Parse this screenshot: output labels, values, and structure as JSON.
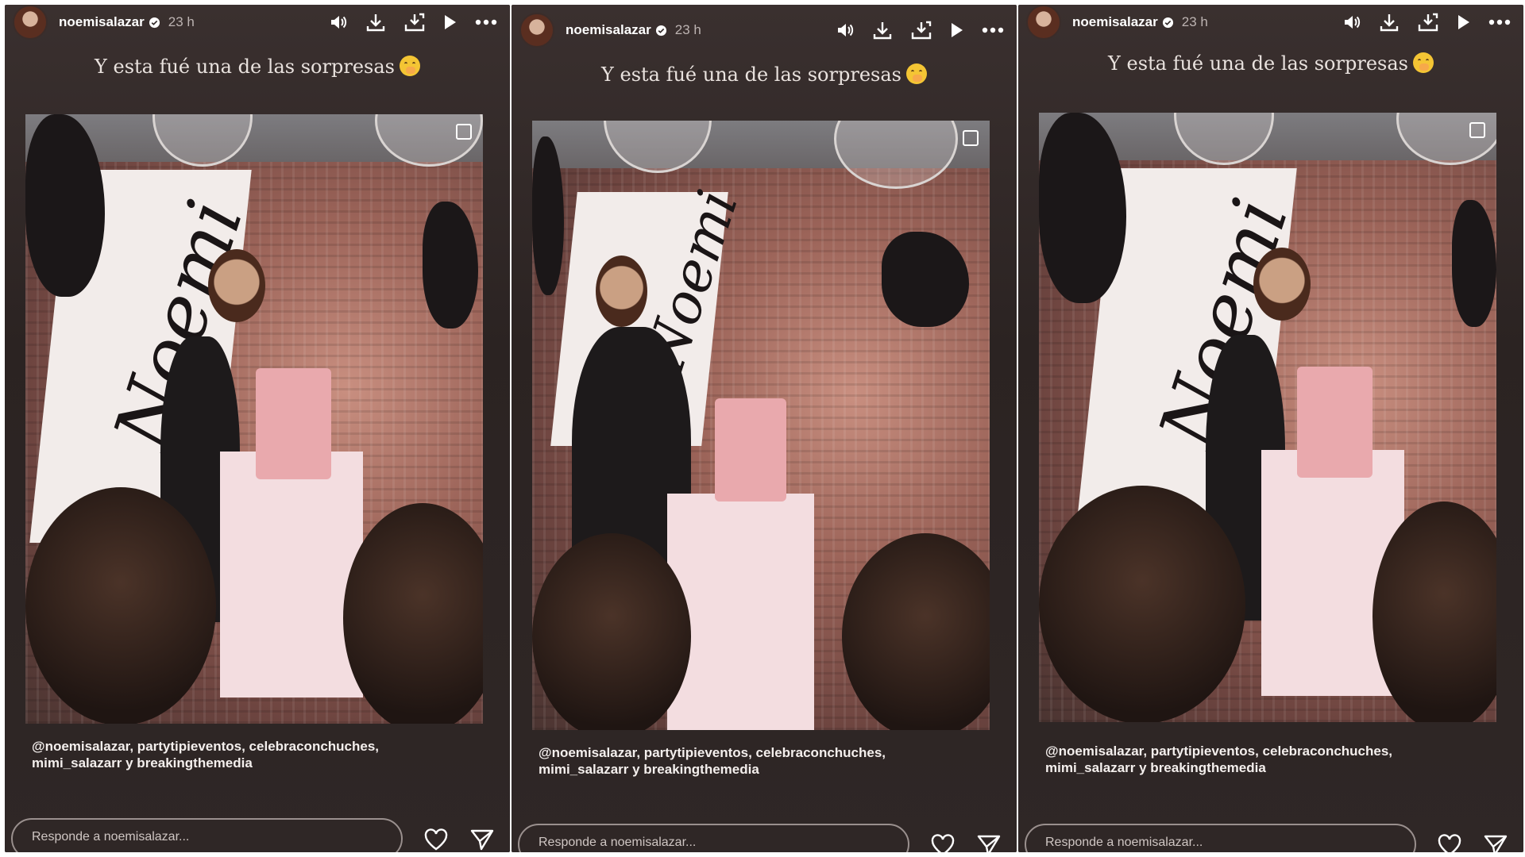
{
  "story": {
    "username": "noemisalazar",
    "time": "23 h",
    "caption": "Y esta fué una de las sorpresas",
    "caption_emoji": "face-with-hand-over-mouth-emoji",
    "mentions_line1": "@noemisalazar, partytipieventos, celebraconchuches,",
    "mentions_line2": "mimi_salazarr y breakingthemedia",
    "reply_placeholder": "Responde a noemisalazar...",
    "banner_text": "Noemi"
  },
  "icons": {
    "verified": "verified-badge-icon",
    "sound": "speaker-icon",
    "download": "download-icon",
    "download_alt": "download-stack-icon",
    "play": "play-icon",
    "more": "more-dots-icon",
    "like": "heart-icon",
    "share": "send-icon",
    "multi": "multiple-media-icon"
  },
  "colors": {
    "panel_bg": "#2f2726",
    "text": "#ffffff",
    "muted": "#bcb3b1",
    "verified": "#ffffff"
  }
}
